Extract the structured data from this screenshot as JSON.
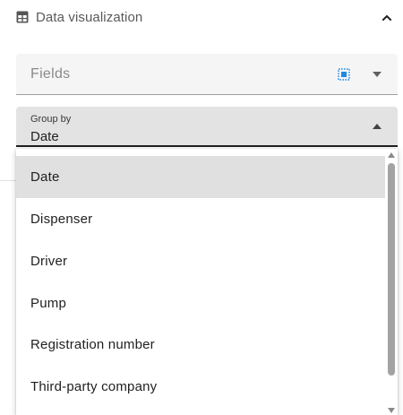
{
  "section": {
    "title": "Data visualization",
    "icon": "table-icon",
    "toggle_icon": "chevron-up-icon"
  },
  "fields_select": {
    "label": "Fields",
    "action_icon": "select-all-icon",
    "caret_icon": "caret-down-icon",
    "accent_color": "#1e88e5"
  },
  "groupby_select": {
    "label": "Group by",
    "value": "Date",
    "caret_icon": "caret-up-icon"
  },
  "menu": {
    "items": [
      {
        "label": "Date",
        "selected": true
      },
      {
        "label": "Dispenser",
        "selected": false
      },
      {
        "label": "Driver",
        "selected": false
      },
      {
        "label": "Pump",
        "selected": false
      },
      {
        "label": "Registration number",
        "selected": false
      },
      {
        "label": "Third-party company",
        "selected": false
      }
    ]
  }
}
